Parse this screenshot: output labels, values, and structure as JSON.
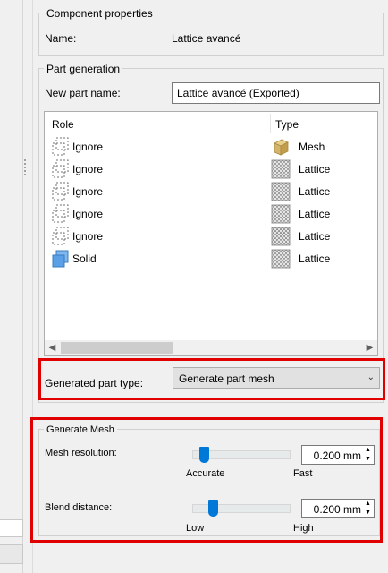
{
  "component_properties": {
    "title": "Component properties",
    "name_label": "Name:",
    "name_value": "Lattice avancé"
  },
  "part_generation": {
    "title": "Part generation",
    "new_part_name_label": "New part name:",
    "new_part_name_value": "Lattice avancé (Exported)",
    "columns": {
      "role": "Role",
      "type": "Type"
    },
    "rows": [
      {
        "role": "Ignore",
        "role_icon": "ignore-dashed-icon",
        "type": "Mesh",
        "type_icon": "mesh-cube-icon"
      },
      {
        "role": "Ignore",
        "role_icon": "ignore-dashed-icon",
        "type": "Lattice",
        "type_icon": "lattice-pattern-icon"
      },
      {
        "role": "Ignore",
        "role_icon": "ignore-dashed-icon",
        "type": "Lattice",
        "type_icon": "lattice-pattern-icon"
      },
      {
        "role": "Ignore",
        "role_icon": "ignore-dashed-icon",
        "type": "Lattice",
        "type_icon": "lattice-pattern-icon"
      },
      {
        "role": "Ignore",
        "role_icon": "ignore-dashed-icon",
        "type": "Lattice",
        "type_icon": "lattice-pattern-icon"
      },
      {
        "role": "Solid",
        "role_icon": "solid-blue-icon",
        "type": "Lattice",
        "type_icon": "lattice-pattern-icon"
      }
    ],
    "generated_part_type_label": "Generated part type:",
    "generated_part_type_value": "Generate part mesh"
  },
  "generate_mesh": {
    "title": "Generate Mesh",
    "mesh_resolution": {
      "label": "Mesh resolution:",
      "value": "0.200 mm",
      "min_label": "Accurate",
      "max_label": "Fast",
      "level": 0.08
    },
    "blend_distance": {
      "label": "Blend distance:",
      "value": "0.200 mm",
      "min_label": "Low",
      "max_label": "High",
      "level": 0.18
    }
  },
  "colors": {
    "highlight": "#e00000",
    "slider_accent": "#0078d7",
    "solid_icon": "#5aa0e6",
    "mesh_icon": "#d4b36a"
  }
}
